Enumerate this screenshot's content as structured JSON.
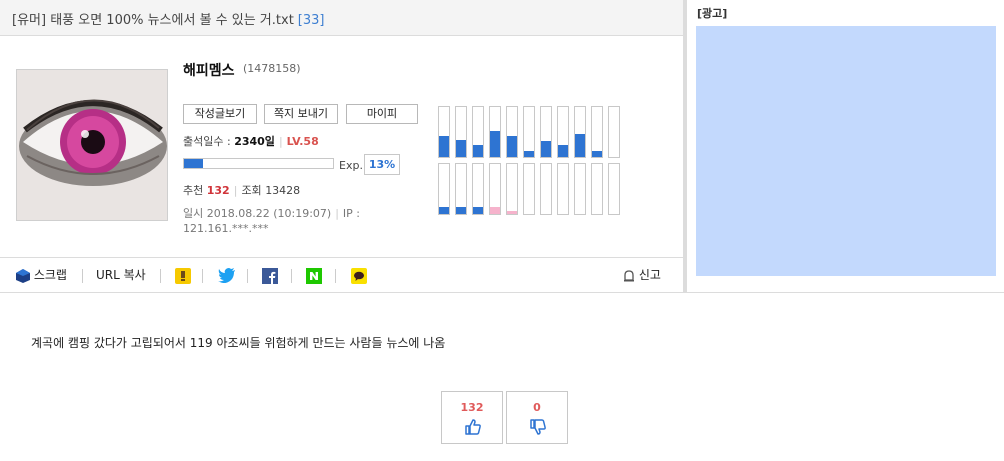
{
  "post": {
    "title": "[유머] 태풍 오면 100% 뉴스에서 볼 수 있는 거.txt",
    "comment_count": "[33]",
    "body": "계곡에 캠핑 갔다가 고립되어서 119 아조씨들 위험하게 만드는 사람들 뉴스에 나옴"
  },
  "author": {
    "nickname": "해피멤스",
    "id": "(1478158)",
    "photo_icon": "pink-eye-photo",
    "buttons": {
      "posts": "작성글보기",
      "memo": "쪽지 보내기",
      "mypi": "마이피"
    },
    "attendance_label": "출석일수 :",
    "attendance_value": "2340일",
    "level": "LV.58",
    "exp_label": "Exp.",
    "exp_percent": "13%",
    "exp_fraction": 0.13,
    "recommend_label": "추천",
    "recommend_value": "132",
    "views_label": "조회",
    "views_value": "13428",
    "date_text": "일시 2018.08.22 (10:19:07)",
    "ip_label": "IP :",
    "ip_value": "121.161.***.***"
  },
  "activity_bars": {
    "top": [
      0.42,
      0.35,
      0.24,
      0.52,
      0.42,
      0.12,
      0.32,
      0.24,
      0.46,
      0.12,
      0.0
    ],
    "bottom": [
      0.14,
      0.14,
      0.14,
      0.14,
      0.06,
      0.0,
      0.0,
      0.0,
      0.0,
      0.0,
      0.0
    ],
    "bottom_colors": [
      "#2e74d2",
      "#2e74d2",
      "#2e74d2",
      "#f6b3cc",
      "#f6b3cc",
      "#2e74d2",
      "#2e74d2",
      "#2e74d2",
      "#2e74d2",
      "#2e74d2",
      "#2e74d2"
    ]
  },
  "share": {
    "scrap_label": "스크랩",
    "url_copy_label": "URL 복사",
    "report_label": "신고",
    "icons": [
      "kakaostory-icon",
      "twitter-icon",
      "facebook-icon",
      "naver-icon",
      "kakaotalk-icon"
    ]
  },
  "ad": {
    "label": "[광고]"
  },
  "votes": {
    "up": "132",
    "down": "0"
  },
  "colors": {
    "accent_blue": "#2e74d2",
    "level_red": "#d9534f",
    "ad_bg": "#c3d9fd"
  }
}
